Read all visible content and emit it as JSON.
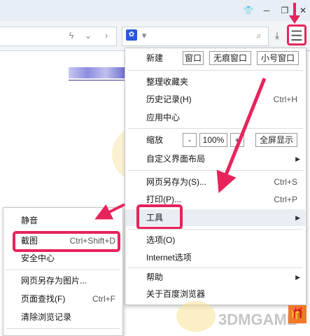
{
  "main_menu": {
    "new_label": "新建",
    "new_window": "窗口",
    "new_incognito": "无痕窗口",
    "new_mini": "小号窗口",
    "organize_favorites": "整理收藏夹",
    "history": "历史记录(H)",
    "history_shortcut": "Ctrl+H",
    "app_center": "应用中心",
    "zoom_label": "缩放",
    "zoom_minus": "-",
    "zoom_value": "100%",
    "zoom_plus": "+",
    "fullscreen": "全屏显示",
    "custom_layout": "自定义界面布局",
    "save_as": "网页另存为(S)...",
    "save_as_shortcut": "Ctrl+S",
    "print": "打印(P)...",
    "print_shortcut": "Ctrl+P",
    "tools": "工具",
    "options": "选项(O)",
    "internet_options": "Internet选项",
    "help": "帮助",
    "about": "关于百度浏览器"
  },
  "sub_menu": {
    "mute": "静音",
    "screenshot": "截图",
    "screenshot_shortcut": "Ctrl+Shift+D",
    "security_center": "安全中心",
    "save_as_image": "网页另存为图片...",
    "find_in_page": "页面查找(F)",
    "find_shortcut": "Ctrl+F",
    "clear_history": "清除浏览记录"
  },
  "watermark": {
    "text": "3DMGAME"
  },
  "colors": {
    "highlight": "#e6245b",
    "menu_hover": "#e9eef4"
  }
}
